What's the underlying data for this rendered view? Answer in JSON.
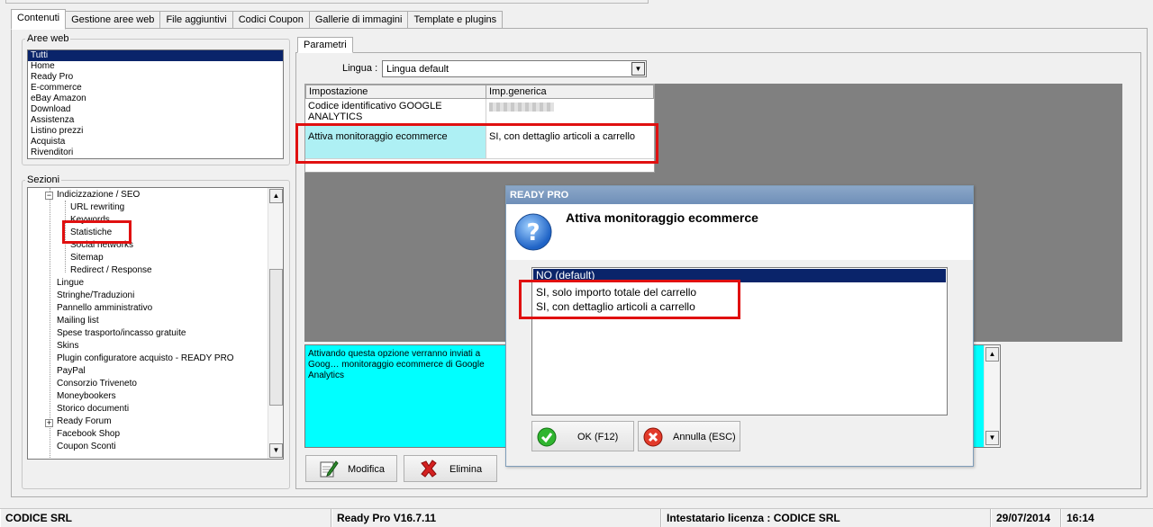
{
  "tabs": [
    "Contenuti",
    "Gestione aree web",
    "File aggiuntivi",
    "Codici Coupon",
    "Gallerie di immagini",
    "Template e plugins"
  ],
  "aree_web": {
    "label": "Aree web",
    "items": [
      "Tutti",
      "Home",
      "Ready Pro",
      "E-commerce",
      "eBay Amazon",
      "Download",
      "Assistenza",
      "Listino prezzi",
      "Acquista",
      "Rivenditori"
    ],
    "selected": "Tutti"
  },
  "sezioni": {
    "label": "Sezioni",
    "items": [
      {
        "label": "Indicizzazione / SEO",
        "level": 1,
        "expander": "−"
      },
      {
        "label": "URL rewriting",
        "level": 2
      },
      {
        "label": "Keywords",
        "level": 2
      },
      {
        "label": "Statistiche",
        "level": 2
      },
      {
        "label": "Social networks",
        "level": 2
      },
      {
        "label": "Sitemap",
        "level": 2
      },
      {
        "label": "Redirect / Response",
        "level": 2
      },
      {
        "label": "Lingue",
        "level": 1
      },
      {
        "label": "Stringhe/Traduzioni",
        "level": 1
      },
      {
        "label": "Pannello amministrativo",
        "level": 1
      },
      {
        "label": "Mailing list",
        "level": 1
      },
      {
        "label": "Spese trasporto/incasso gratuite",
        "level": 1
      },
      {
        "label": "Skins",
        "level": 1
      },
      {
        "label": "Plugin configuratore acquisto - READY PRO",
        "level": 1
      },
      {
        "label": "PayPal",
        "level": 1
      },
      {
        "label": "Consorzio Triveneto",
        "level": 1
      },
      {
        "label": "Moneybookers",
        "level": 1
      },
      {
        "label": "Storico documenti",
        "level": 1
      },
      {
        "label": "Ready Forum",
        "level": 1,
        "expander": "+"
      },
      {
        "label": "Facebook Shop",
        "level": 1
      },
      {
        "label": "Coupon Sconti",
        "level": 1
      }
    ]
  },
  "parametri": {
    "tab_label": "Parametri",
    "lingua_label": "Lingua :",
    "lingua_value": "Lingua default",
    "col_impostazione": "Impostazione",
    "col_valore": "Imp.generica",
    "rows": [
      {
        "name": "Codice identificativo GOOGLE ANALYTICS",
        "value": ""
      },
      {
        "name": "Attiva monitoraggio ecommerce",
        "value": "SI, con dettaglio articoli a carrello"
      }
    ],
    "description": "Attivando questa opzione verranno inviati a Goog… monitoraggio ecommerce di Google Analytics",
    "modifica_label": "Modifica",
    "elimina_label": "Elimina"
  },
  "dialog": {
    "title": "READY PRO",
    "heading": "Attiva monitoraggio ecommerce",
    "options": [
      "NO (default)",
      "SI, solo importo totale del carrello",
      "SI, con dettaglio articoli a carrello"
    ],
    "selected_index": 0,
    "ok_label": "OK (F12)",
    "cancel_label": "Annulla (ESC)"
  },
  "statusbar": {
    "company": "CODICE SRL",
    "version": "Ready Pro V16.7.11",
    "license": "Intestatario licenza : CODICE SRL",
    "date": "29/07/2014",
    "time": "16:14"
  },
  "colors": {
    "highlight_cyan": "#aef0f4",
    "description_bg": "#00ffff",
    "selection_navy": "#0a246a",
    "annotation_red": "#e01010"
  }
}
